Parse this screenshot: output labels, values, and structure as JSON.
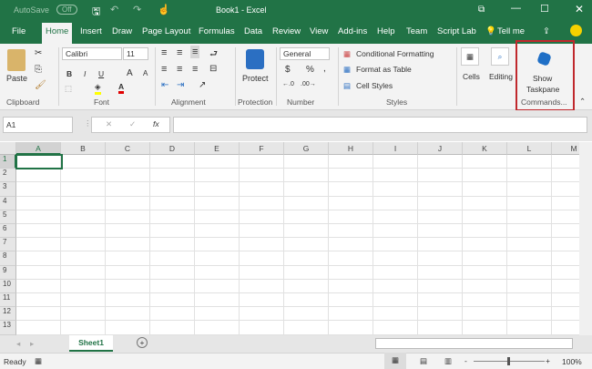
{
  "title": {
    "autosave": "AutoSave",
    "autosave_state": "Off",
    "window_title": "Book1 - Excel"
  },
  "tabs": [
    "File",
    "Home",
    "Insert",
    "Draw",
    "Page Layout",
    "Formulas",
    "Data",
    "Review",
    "View",
    "Add-ins",
    "Help",
    "Team",
    "Script Lab"
  ],
  "tell_me": "Tell me",
  "ribbon": {
    "clipboard": {
      "paste": "Paste",
      "label": "Clipboard"
    },
    "font": {
      "name": "Calibri",
      "size": "11",
      "bold": "B",
      "italic": "I",
      "underline": "U",
      "grow": "A",
      "shrink": "A",
      "color": "A",
      "label": "Font"
    },
    "alignment": {
      "label": "Alignment"
    },
    "protection": {
      "protect": "Protect",
      "label": "Protection"
    },
    "number": {
      "format": "General",
      "currency": "$",
      "percent": "%",
      "comma": ",",
      "label": "Number"
    },
    "styles": {
      "conditional": "Conditional Formatting",
      "format_table": "Format as Table",
      "cell_styles": "Cell Styles",
      "label": "Styles"
    },
    "cells": "Cells",
    "editing": "Editing",
    "commands": {
      "show": "Show",
      "taskpane": "Taskpane",
      "label": "Commands..."
    }
  },
  "formula_bar": {
    "name_box": "A1",
    "fx": "fx",
    "value": ""
  },
  "columns": [
    "A",
    "B",
    "C",
    "D",
    "E",
    "F",
    "G",
    "H",
    "I",
    "J",
    "K",
    "L",
    "M"
  ],
  "rows": [
    "1",
    "2",
    "3",
    "4",
    "5",
    "6",
    "7",
    "8",
    "9",
    "10",
    "11",
    "12",
    "13"
  ],
  "sheets": [
    "Sheet1"
  ],
  "status": {
    "ready": "Ready",
    "zoom": "100%",
    "minus": "-",
    "plus": "+"
  },
  "colors": {
    "brand": "#217346",
    "highlight": "#c0282d"
  }
}
